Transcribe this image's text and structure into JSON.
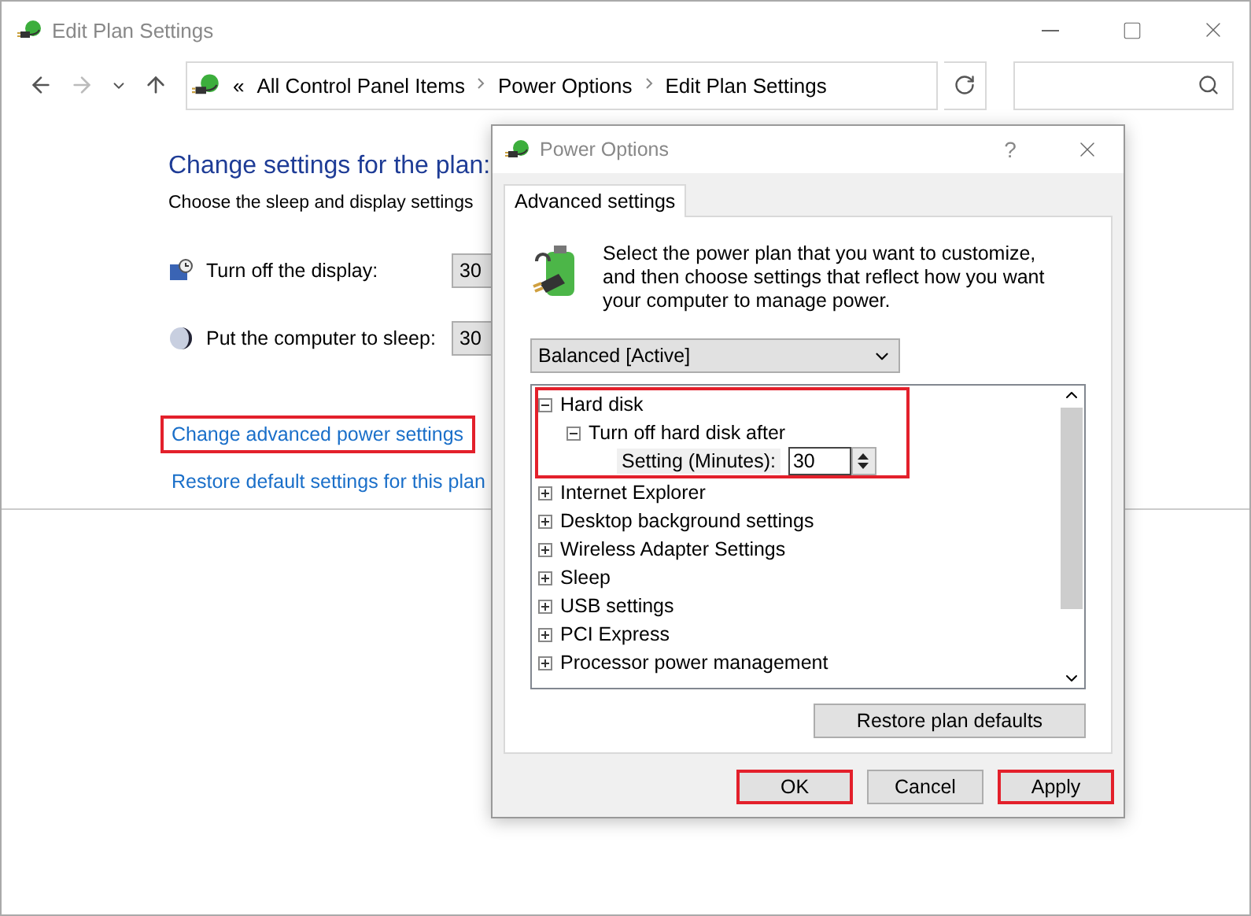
{
  "main_window": {
    "title": "Edit Plan Settings",
    "breadcrumb_overflow": "«",
    "breadcrumb": [
      "All Control Panel Items",
      "Power Options",
      "Edit Plan Settings"
    ],
    "heading": "Change settings for the plan:",
    "subheading": "Choose the sleep and display settings",
    "settings": [
      {
        "kind": "display",
        "label": "Turn off the display:",
        "value": "30"
      },
      {
        "kind": "sleep",
        "label": "Put the computer to sleep:",
        "value": "30"
      }
    ],
    "links": [
      {
        "text": "Change advanced power settings",
        "highlighted": true
      },
      {
        "text": "Restore default settings for this plan",
        "highlighted": false
      }
    ]
  },
  "dialog": {
    "title": "Power Options",
    "help": "?",
    "tabs": [
      {
        "label": "Advanced settings",
        "selected": true
      }
    ],
    "description": "Select the power plan that you want to customize, and then choose settings that reflect how you want your computer to manage power.",
    "plan_select": "Balanced [Active]",
    "tree": [
      {
        "kind": "group",
        "label": "Hard disk",
        "expanded": true,
        "highlighted": true,
        "children": [
          {
            "kind": "group",
            "label": "Turn off hard disk after",
            "expanded": true,
            "highlighted": false,
            "children": [
              {
                "kind": "setting",
                "label": "Setting (Minutes):",
                "value": "30"
              }
            ]
          }
        ]
      },
      {
        "kind": "group",
        "label": "Internet Explorer",
        "expanded": false,
        "highlighted": false
      },
      {
        "kind": "group",
        "label": "Desktop background settings",
        "expanded": false,
        "highlighted": false
      },
      {
        "kind": "group",
        "label": "Wireless Adapter Settings",
        "expanded": false,
        "highlighted": false
      },
      {
        "kind": "group",
        "label": "Sleep",
        "expanded": false,
        "highlighted": false
      },
      {
        "kind": "group",
        "label": "USB settings",
        "expanded": false,
        "highlighted": false
      },
      {
        "kind": "group",
        "label": "PCI Express",
        "expanded": false,
        "highlighted": false
      },
      {
        "kind": "group",
        "label": "Processor power management",
        "expanded": false,
        "highlighted": false
      }
    ],
    "restore_button": "Restore plan defaults",
    "buttons": [
      {
        "label": "OK",
        "highlighted": true
      },
      {
        "label": "Cancel",
        "highlighted": false
      },
      {
        "label": "Apply",
        "highlighted": true
      }
    ]
  }
}
